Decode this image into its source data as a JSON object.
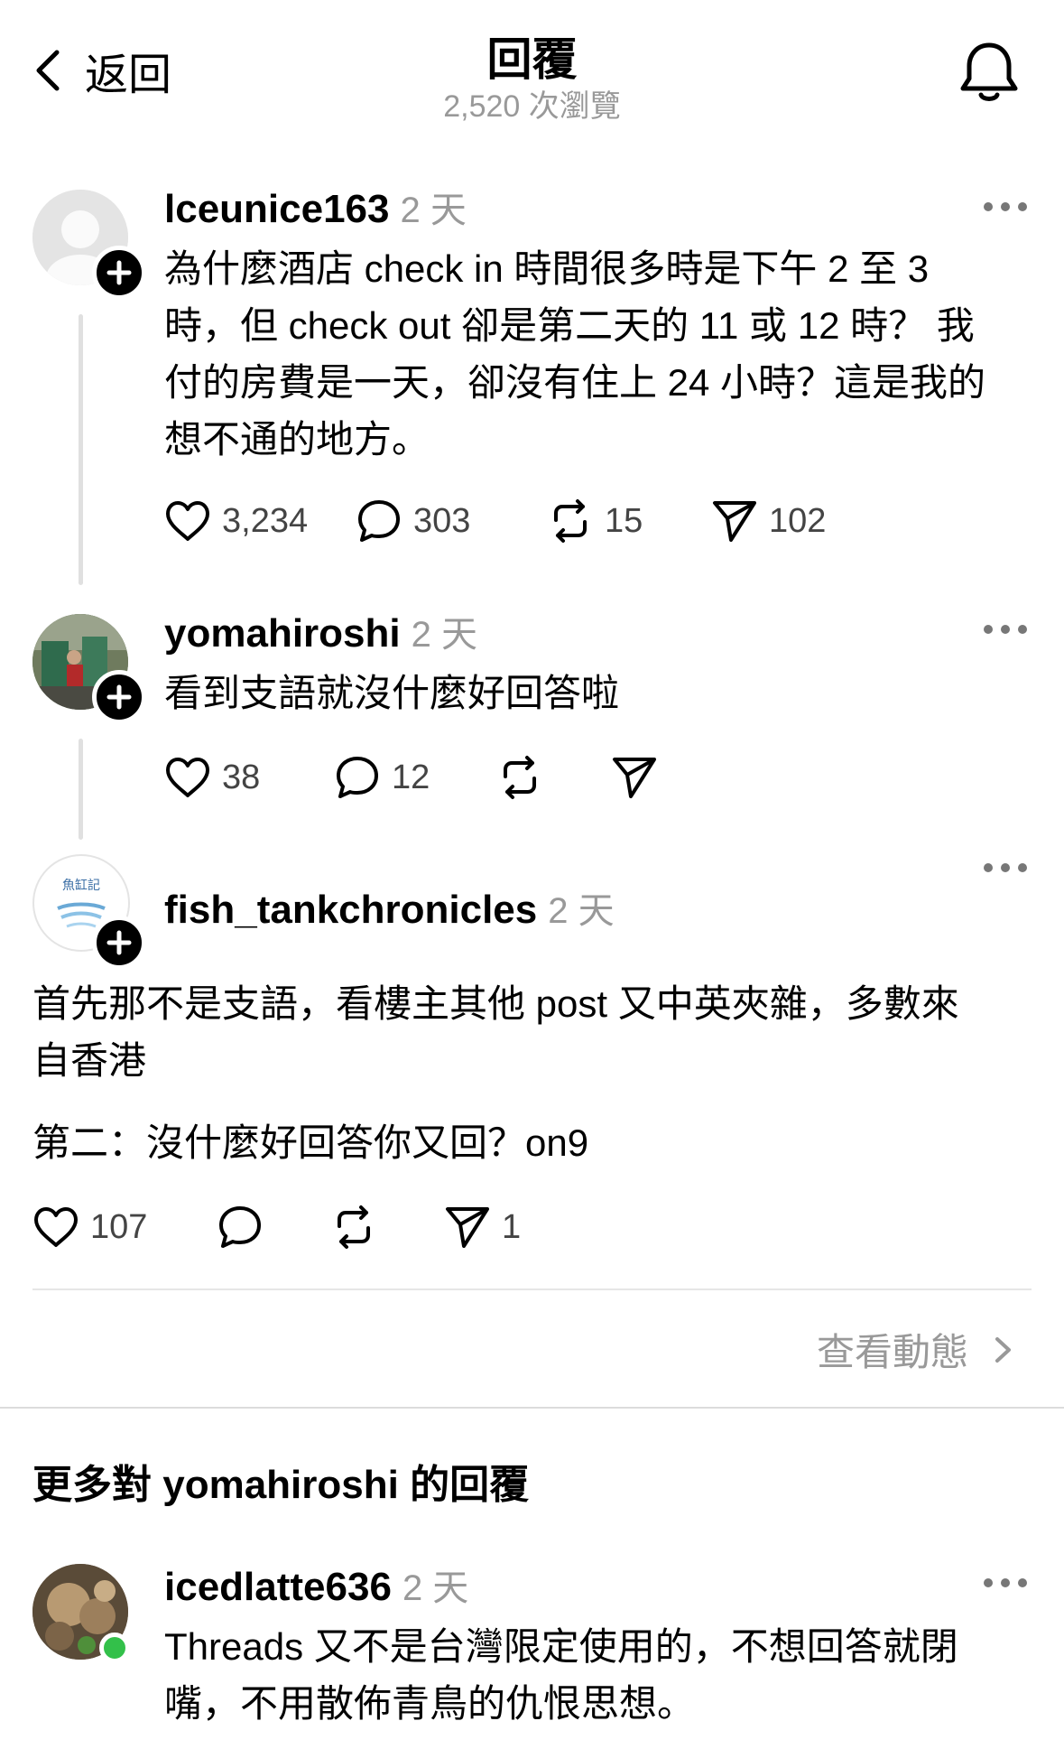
{
  "header": {
    "back_label": "返回",
    "title": "回覆",
    "views": "2,520 次瀏覽"
  },
  "posts": [
    {
      "username": "lceunice163",
      "time": "2 天",
      "lines": [
        "為什麼酒店 check in 時間很多時是下午 2 至 3",
        "時，但 check out 卻是第二天的 11 或 12 時？  我",
        "付的房費是一天，卻沒有住上 24 小時？這是我的",
        "想不通的地方。"
      ],
      "likes": "3,234",
      "comments": "303",
      "reposts": "15",
      "shares": "102"
    },
    {
      "username": "yomahiroshi",
      "time": "2 天",
      "text": "看到支語就沒什麼好回答啦",
      "likes": "38",
      "comments": "12",
      "reposts": "",
      "shares": ""
    },
    {
      "username": "fish_tankchronicles",
      "time": "2 天",
      "avatar_text": "魚缸記",
      "paragraph1": [
        "首先那不是支語，看樓主其他 post 又中英夾雜，多數來",
        "自香港"
      ],
      "paragraph2": "第二：沒什麼好回答你又回？on9",
      "likes": "107",
      "comments": "",
      "reposts": "",
      "shares": "1"
    }
  ],
  "see_activity_label": "查看動態",
  "more_replies_heading": "更多對 yomahiroshi 的回覆",
  "reply": {
    "username": "icedlatte636",
    "time": "2 天",
    "lines": [
      "Threads 又不是台灣限定使用的，不想回答就閉",
      "嘴，不用散佈青鳥的仇恨思想。"
    ]
  },
  "colors": {
    "text": "#000000",
    "muted": "#999999",
    "divider": "#e6e6e6",
    "online": "#33c04a"
  }
}
